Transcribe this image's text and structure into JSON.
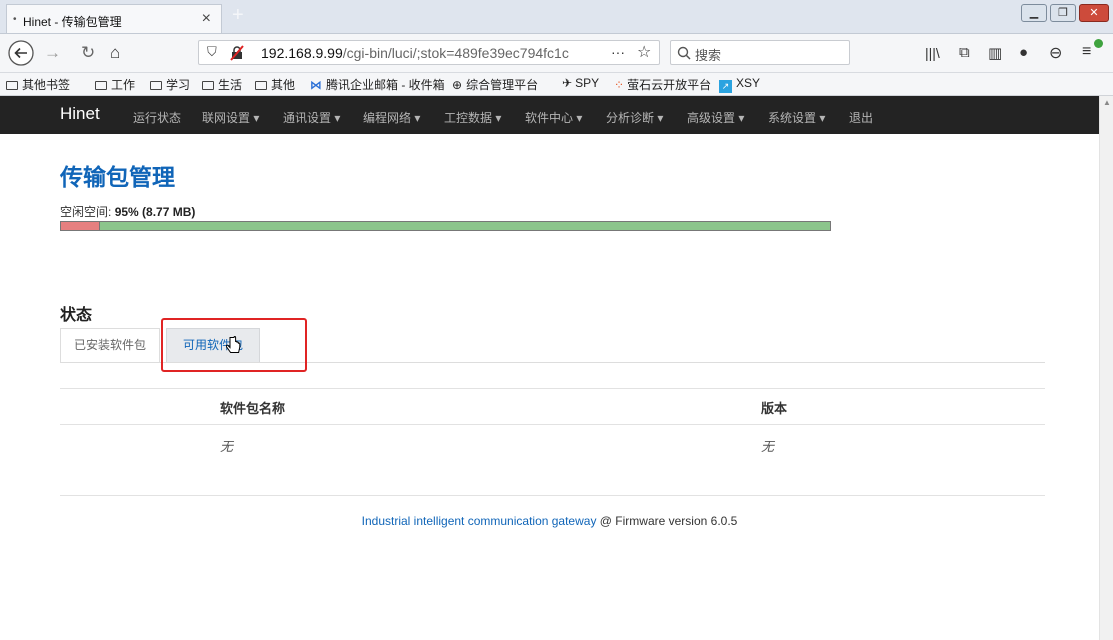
{
  "browser": {
    "tab_title": "Hinet - 传输包管理",
    "tab_close": "×",
    "new_tab": "+",
    "url_host": "192.168.9.99",
    "url_path": "/cgi-bin/luci/;stok=489fe39ec794fc1c",
    "search_placeholder": "搜索",
    "url_more": "···"
  },
  "bookmarks": [
    {
      "label": "其他书签",
      "type": "folder"
    },
    {
      "label": "工作",
      "type": "folder"
    },
    {
      "label": "学习",
      "type": "folder"
    },
    {
      "label": "生活",
      "type": "folder"
    },
    {
      "label": "其他",
      "type": "folder"
    },
    {
      "label": "腾讯企业邮箱 - 收件箱",
      "type": "link",
      "icon": "mail-icon"
    },
    {
      "label": "综合管理平台",
      "type": "link",
      "icon": "globe-icon"
    },
    {
      "label": "SPY",
      "type": "link",
      "icon": "plane-icon"
    },
    {
      "label": "萤石云开放平台",
      "type": "link",
      "icon": "dots-icon"
    },
    {
      "label": "XSY",
      "type": "link",
      "icon": "xsy-icon"
    }
  ],
  "app": {
    "brand": "Hinet",
    "menu": [
      {
        "label": "运行状态"
      },
      {
        "label": "联网设置 ▾"
      },
      {
        "label": "通讯设置 ▾"
      },
      {
        "label": "编程网络 ▾"
      },
      {
        "label": "工控数据 ▾"
      },
      {
        "label": "软件中心 ▾"
      },
      {
        "label": "分析诊断 ▾"
      },
      {
        "label": "高级设置 ▾"
      },
      {
        "label": "系统设置 ▾"
      },
      {
        "label": "退出"
      }
    ]
  },
  "page": {
    "title": "传输包管理",
    "free_space_label": "空闲空间:",
    "free_space_value": "95% (8.77 MB)",
    "free_fraction": 0.95,
    "status_title": "状态",
    "tabs": [
      {
        "label": "已安装软件包",
        "active": false
      },
      {
        "label": "可用软件包",
        "active": true
      }
    ],
    "table": {
      "headers": [
        "软件包名称",
        "版本"
      ],
      "row": [
        "无",
        "无"
      ]
    }
  },
  "footer": {
    "link_text": "Industrial intelligent communication gateway",
    "rest_text": " @ Firmware version 6.0.5"
  },
  "colors": {
    "brand_blue": "#1065b8",
    "nav_bg": "#232323",
    "used_color": "#e68080",
    "free_color": "#8cc58c",
    "highlight": "#e02424"
  }
}
